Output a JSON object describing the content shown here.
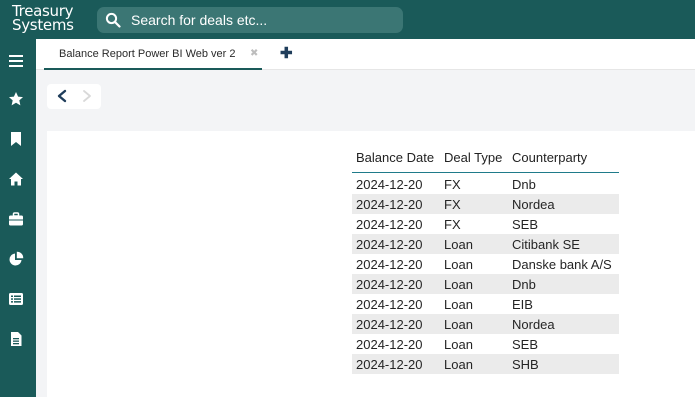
{
  "app": {
    "logo_line1": "Treasury",
    "logo_line2": "Systems",
    "search_placeholder": "Search for deals etc...",
    "accent_color": "#1a5a59"
  },
  "sidebar": {
    "icons": [
      "menu-icon",
      "star-icon",
      "bookmark-icon",
      "home-icon",
      "briefcase-icon",
      "pie-chart-icon",
      "list-icon",
      "document-icon"
    ]
  },
  "tabs": [
    {
      "label": "Balance Report Power BI Web ver 2",
      "close": "✖"
    }
  ],
  "tab_add": "✚",
  "table": {
    "headers": [
      "Balance Date",
      "Deal Type",
      "Counterparty"
    ],
    "rows": [
      [
        "2024-12-20",
        "FX",
        "Dnb"
      ],
      [
        "2024-12-20",
        "FX",
        "Nordea"
      ],
      [
        "2024-12-20",
        "FX",
        "SEB"
      ],
      [
        "2024-12-20",
        "Loan",
        "Citibank SE"
      ],
      [
        "2024-12-20",
        "Loan",
        "Danske bank A/S"
      ],
      [
        "2024-12-20",
        "Loan",
        "Dnb"
      ],
      [
        "2024-12-20",
        "Loan",
        "EIB"
      ],
      [
        "2024-12-20",
        "Loan",
        "Nordea"
      ],
      [
        "2024-12-20",
        "Loan",
        "SEB"
      ],
      [
        "2024-12-20",
        "Loan",
        "SHB"
      ]
    ]
  }
}
